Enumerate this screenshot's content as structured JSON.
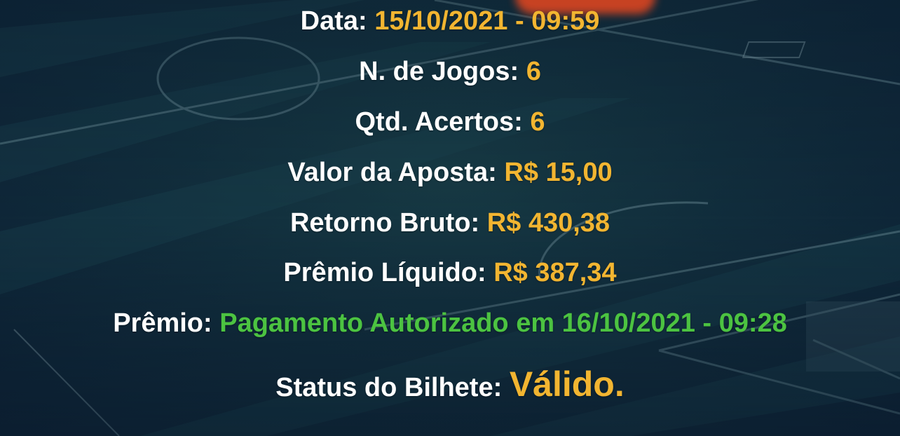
{
  "ticket": {
    "data": {
      "label": "Data:",
      "value": "15/10/2021 - 09:59"
    },
    "jogos": {
      "label": "N. de Jogos:",
      "value": "6"
    },
    "acertos": {
      "label": "Qtd. Acertos:",
      "value": "6"
    },
    "valor_aposta": {
      "label": "Valor da Aposta:",
      "value": "R$ 15,00"
    },
    "retorno_bruto": {
      "label": "Retorno Bruto:",
      "value": "R$ 430,38"
    },
    "premio_liquido": {
      "label": "Prêmio Líquido:",
      "value": "R$ 387,34"
    },
    "premio": {
      "label": "Prêmio:",
      "value": "Pagamento Autorizado em 16/10/2021 - 09:28"
    },
    "status": {
      "label": "Status do Bilhete:",
      "value": "Válido."
    }
  },
  "colors": {
    "label": "#ffffff",
    "value_gold": "#f2b531",
    "value_green": "#4cc341",
    "background": "#112d3c"
  }
}
